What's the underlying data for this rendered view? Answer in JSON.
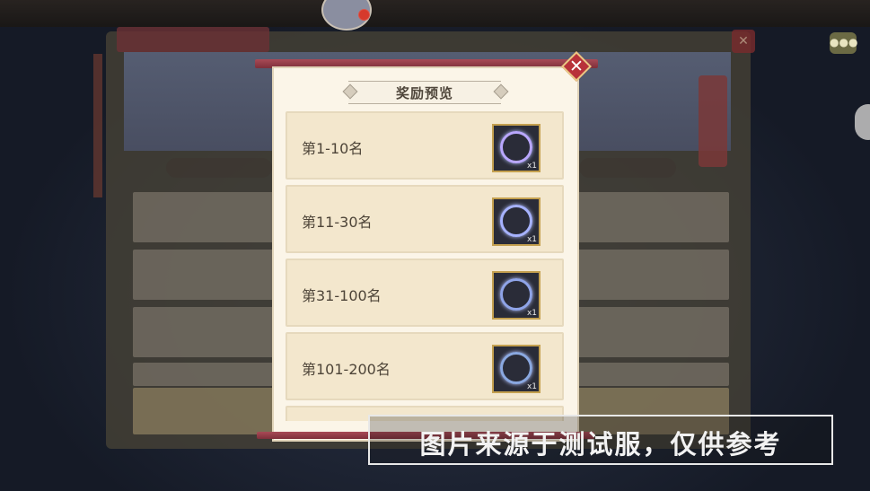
{
  "background": {
    "top_text": "",
    "window_tab": "",
    "bottom_row_text": "",
    "side_banner_text": ""
  },
  "popup": {
    "title": "奖励预览",
    "close_label": "✕",
    "rows": [
      {
        "label": "第1-10名",
        "quantity": "x1"
      },
      {
        "label": "第11-30名",
        "quantity": "x1"
      },
      {
        "label": "第31-100名",
        "quantity": "x1"
      },
      {
        "label": "第101-200名",
        "quantity": "x1"
      }
    ]
  },
  "chat_icon": "chat-bubble-icon",
  "watermark": "图片来源于测试服，仅供参考",
  "colors": {
    "popup_bg": "#fbf5e8",
    "row_bg": "#f3e7cd",
    "accent_red": "#b8323a",
    "item_border": "#c4a04f"
  }
}
